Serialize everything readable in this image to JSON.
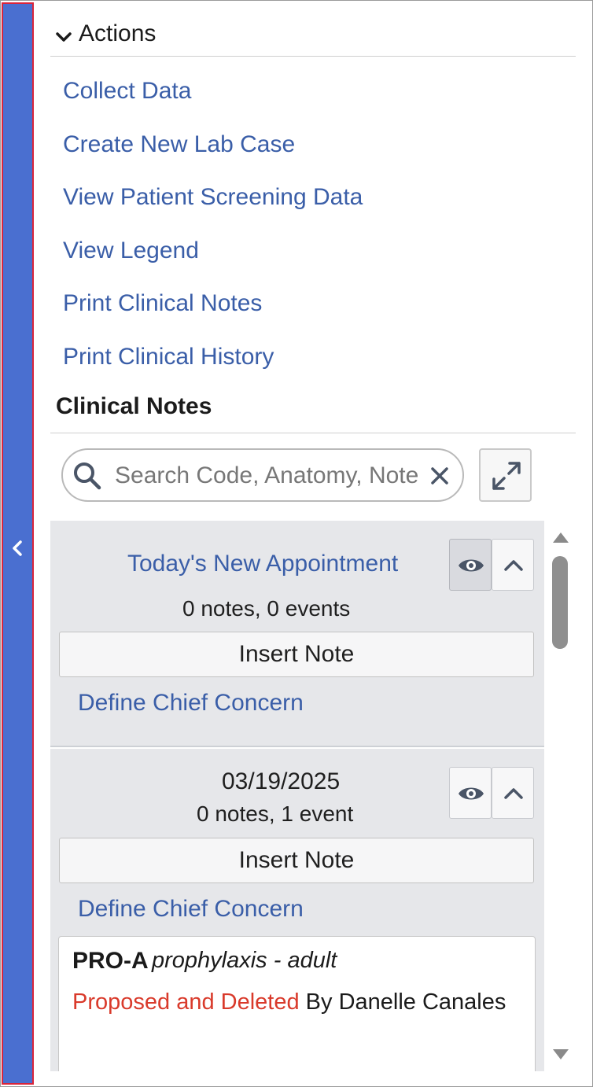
{
  "actions": {
    "title": "Actions",
    "items": [
      {
        "label": "Collect Data"
      },
      {
        "label": "Create New Lab Case"
      },
      {
        "label": "View Patient Screening Data"
      },
      {
        "label": "View Legend"
      },
      {
        "label": "Print Clinical Notes"
      },
      {
        "label": "Print Clinical History"
      }
    ]
  },
  "clinical_notes": {
    "title": "Clinical Notes",
    "search": {
      "placeholder": "Search Code, Anatomy, Note",
      "value": ""
    },
    "appointments": [
      {
        "title": "Today's New Appointment",
        "counts": "0 notes,  0 events",
        "insert_label": "Insert Note",
        "chief_label": "Define Chief Concern"
      },
      {
        "title": "03/19/2025",
        "counts": "0 notes,  1 event",
        "insert_label": "Insert Note",
        "chief_label": "Define Chief Concern",
        "notes": [
          {
            "code": "PRO-A",
            "description": "prophylaxis - adult",
            "status": "Proposed and Deleted",
            "by": " By Danelle Canales"
          }
        ]
      }
    ]
  },
  "icons": {
    "collapse": "chevron-left-icon",
    "section_toggle": "chevron-down-icon",
    "search": "search-icon",
    "clear": "close-icon",
    "expand": "expand-icon",
    "visibility": "eye-icon",
    "collapse_item": "chevron-up-icon"
  },
  "colors": {
    "accent_bar": "#4a6fd0",
    "link": "#3a5ea8",
    "status_deleted": "#d93a2b",
    "appointment_bg": "#e6e7ea"
  }
}
